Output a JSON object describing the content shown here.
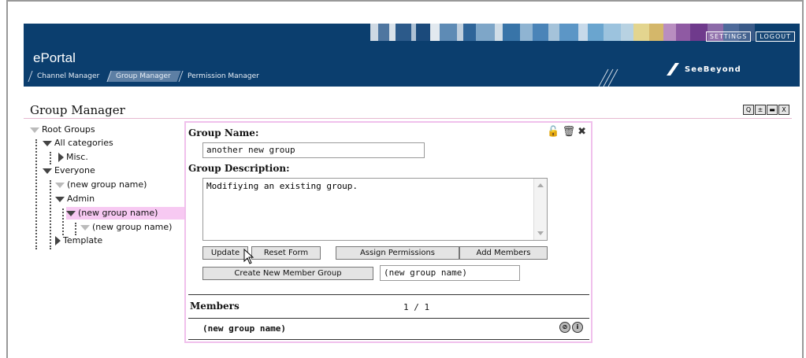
{
  "header": {
    "brand": "ePortal",
    "top_buttons": [
      "SETTINGS",
      "LOGOUT"
    ],
    "tabs": [
      "Channel Manager",
      "Group Manager",
      "Permission Manager"
    ],
    "active_tab": "Group Manager",
    "logo_text": "SeeBeyond"
  },
  "page": {
    "title": "Group Manager",
    "window_icons": [
      "Q",
      "±",
      "▬",
      "X"
    ]
  },
  "tree": {
    "items": [
      {
        "label": "Root Groups"
      },
      {
        "label": "All categories"
      },
      {
        "label": "Misc."
      },
      {
        "label": "Everyone"
      },
      {
        "label": "(new group name)"
      },
      {
        "label": "Admin"
      },
      {
        "label": "(new group name)"
      },
      {
        "label": "(new group name)"
      },
      {
        "label": "Template"
      }
    ]
  },
  "form": {
    "group_name_label": "Group Name:",
    "group_name_value": "another new group",
    "group_description_label": "Group Description:",
    "group_description_value": "Modifiying an existing group.",
    "buttons": {
      "update": "Update",
      "reset": "Reset Form",
      "assign_permissions": "Assign Permissions",
      "add_members": "Add Members",
      "create_member_group": "Create New Member Group"
    },
    "new_member_group_value": "(new group name)"
  },
  "members": {
    "heading": "Members",
    "pagination": "1 / 1",
    "rows": [
      {
        "name": "(new group name)"
      }
    ]
  }
}
